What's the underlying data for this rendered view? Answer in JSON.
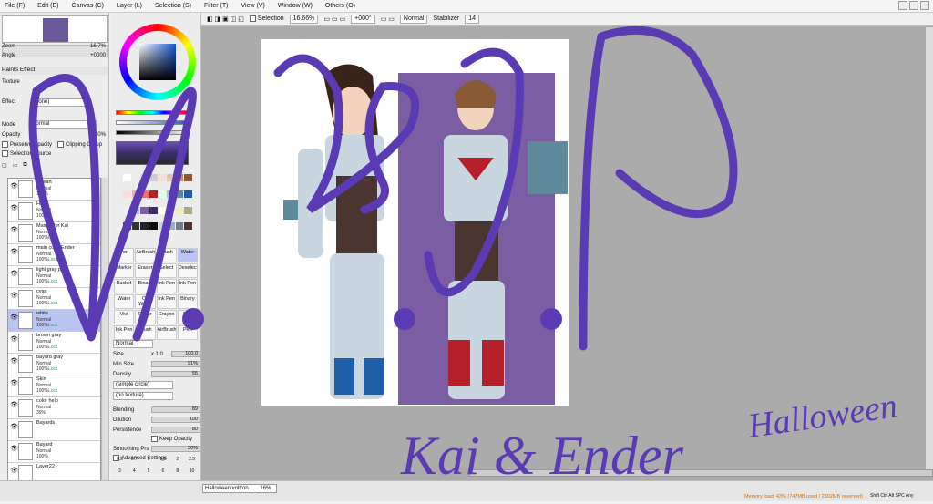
{
  "menu": [
    "File (F)",
    "Edit (E)",
    "Canvas (C)",
    "Layer (L)",
    "Selection (S)",
    "Filter (T)",
    "View (V)",
    "Window (W)",
    "Others (O)"
  ],
  "navigator": {
    "zoom_label": "Zoom",
    "zoom_value": "16.7%",
    "angle_label": "Angle",
    "angle_value": "+0000"
  },
  "paints": {
    "title": "Paints Effect",
    "texture": "Texture",
    "effect": "Effect",
    "effect_value": "(none)",
    "mode_label": "Mode",
    "mode_value": "Normal",
    "opacity_label": "Opacity",
    "opacity_value": "100%",
    "preserve": "Preserve Opacity",
    "clipping": "Clipping Group",
    "selection_source": "Selection Source"
  },
  "layers": [
    {
      "name": "Lineart",
      "mode": "Normal",
      "op": "100%",
      "lock": ""
    },
    {
      "name": "Hair",
      "mode": "Normal",
      "op": "100%",
      "lock": ""
    },
    {
      "name": "Main color Kai",
      "mode": "Normal",
      "op": "100%",
      "lock": "Lock"
    },
    {
      "name": "main color Ender",
      "mode": "Normal",
      "op": "100%",
      "lock": "Lock"
    },
    {
      "name": "light gray pack",
      "mode": "Normal",
      "op": "100%",
      "lock": "Lock"
    },
    {
      "name": "cyan",
      "mode": "Normal",
      "op": "100%",
      "lock": "Lock"
    },
    {
      "name": "white",
      "mode": "Normal",
      "op": "100%",
      "lock": "Lock"
    },
    {
      "name": "brown gray",
      "mode": "Normal",
      "op": "100%",
      "lock": "Lock"
    },
    {
      "name": "bayard gray",
      "mode": "Normal",
      "op": "100%",
      "lock": "Lock"
    },
    {
      "name": "Skin",
      "mode": "Normal",
      "op": "100%",
      "lock": "Lock"
    },
    {
      "name": "color help",
      "mode": "Normal",
      "op": "39%",
      "lock": ""
    },
    {
      "name": "Bayards",
      "mode": "",
      "op": "",
      "lock": ""
    },
    {
      "name": "Bayard",
      "mode": "Normal",
      "op": "100%",
      "lock": ""
    },
    {
      "name": "Layer22",
      "mode": "",
      "op": "",
      "lock": ""
    }
  ],
  "tools": [
    "Pen",
    "AirBrush",
    "Brush",
    "Water",
    "Marker",
    "Eraser",
    "Select",
    "Deselect",
    "Bucket",
    "Binary",
    "Ink Pen",
    "Ink Pen",
    "Water",
    "Oil Water",
    "Ink Pen",
    "Binary",
    "Vivi",
    "Paper",
    "Crayon",
    "Blur",
    "Ink Pen",
    "Brush",
    "AirBrush",
    "Pen"
  ],
  "brush": {
    "mode": "Normal",
    "size_label": "Size",
    "size_mult": "x 1.0",
    "size_value": "100.0",
    "minsize_label": "Min Size",
    "minsize_value": "91%",
    "density_label": "Density",
    "density_value": "55",
    "shape": "(simple circle)",
    "texture": "(no texture)",
    "blending_label": "Blending",
    "blending_value": "89",
    "dilution_label": "Dilution",
    "dilution_value": "100",
    "persistence_label": "Persistence",
    "persistence_value": "80",
    "keep_opacity": "Keep Opacity",
    "smoothing_label": "Smoothing Prs",
    "smoothing_value": "50%",
    "advanced": "Advanced Settings"
  },
  "brush_sizes": [
    "0.5",
    "0.7",
    "1",
    "1.5",
    "2",
    "2.5",
    "3",
    "4",
    "5",
    "6",
    "8",
    "10",
    "12",
    "15",
    "20",
    "25",
    "30",
    "35",
    "40",
    "45",
    "50"
  ],
  "canvas_toolbar": {
    "selection_label": "Selection",
    "zoom": "16.66%",
    "angle": "+000°",
    "blend": "Normal",
    "stabilizer_label": "Stabilizer",
    "stabilizer_value": "14"
  },
  "status": {
    "doc_tab": "Halloween voltron ...",
    "doc_zoom": "16%",
    "memory": "Memory load: 43% (747MB used / 2302MB reserved)",
    "keys": "Shift Ctrl Alt SPC Any"
  },
  "artwork": {
    "watermark": "W.D.P",
    "title_script": "Halloween",
    "subtitle_script": "Kai & Ender"
  }
}
